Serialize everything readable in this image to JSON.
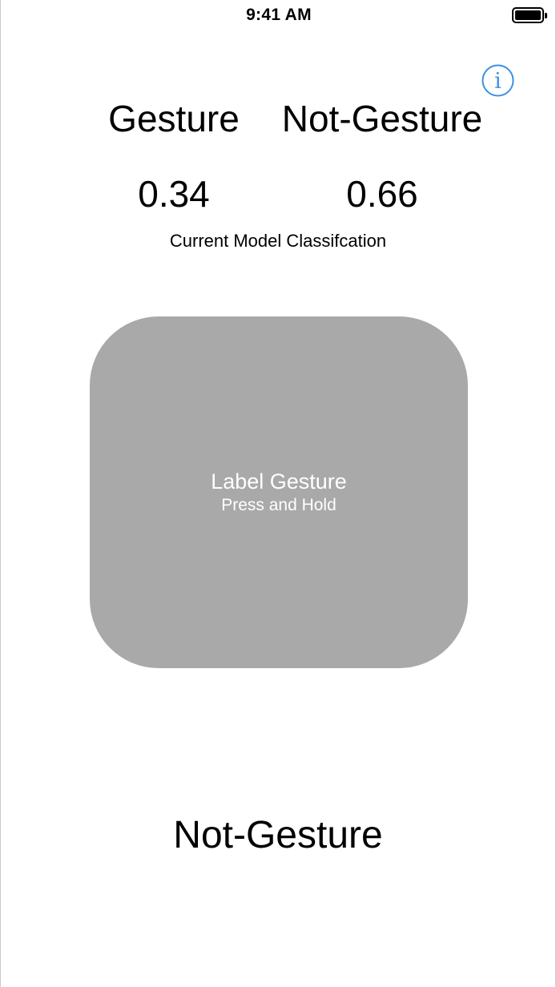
{
  "status_bar": {
    "time": "9:41 AM",
    "battery_icon": "battery-full-icon"
  },
  "header": {
    "info_icon": "info-icon",
    "info_glyph": "i",
    "accent_color": "#3d8fe6"
  },
  "classes": [
    {
      "label": "Gesture",
      "score": "0.34"
    },
    {
      "label": "Not-Gesture",
      "score": "0.66"
    }
  ],
  "caption": "Current Model Classifcation",
  "pad": {
    "title": "Label Gesture",
    "subtitle": "Press and Hold",
    "color": "#a9a9a9"
  },
  "result": "Not-Gesture"
}
